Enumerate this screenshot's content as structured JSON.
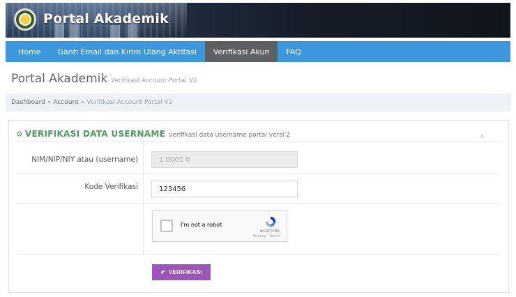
{
  "header": {
    "title": "Portal Akademik"
  },
  "nav": {
    "items": [
      {
        "label": "Home",
        "active": false
      },
      {
        "label": "Ganti Email dan Kirim Ulang Aktifasi",
        "active": false
      },
      {
        "label": "Verifikasi Akun",
        "active": true
      },
      {
        "label": "FAQ",
        "active": false
      }
    ]
  },
  "page": {
    "title": "Portal Akademik",
    "subtitle": "Verifikasi Account Portal V2"
  },
  "breadcrumb": {
    "items": [
      "Dashboard",
      "Account",
      "Verifikasi Account Portal V2"
    ],
    "separator": "»"
  },
  "form": {
    "icon": "cogs-icon",
    "title": "VERIFIKASI DATA USERNAME",
    "description": "verifikasi data username portal versi 2",
    "collapse_label": "o",
    "fields": {
      "username": {
        "label": "NIM/NIP/NIY atau (username)",
        "value": "1 0001 0",
        "disabled": true
      },
      "code": {
        "label": "Kode Verifikasi",
        "value": "123456",
        "disabled": false
      }
    },
    "recaptcha": {
      "checkbox_label": "I'm not a robot",
      "brand": "reCAPTCHA",
      "links": "Privacy - Terms"
    },
    "submit_label": "VERIFIKASI"
  },
  "colors": {
    "navbar": "#3c97dd",
    "nav_active": "#5e5f63",
    "accent_green": "#4a9c5d",
    "button_purple": "#9c55b8"
  }
}
